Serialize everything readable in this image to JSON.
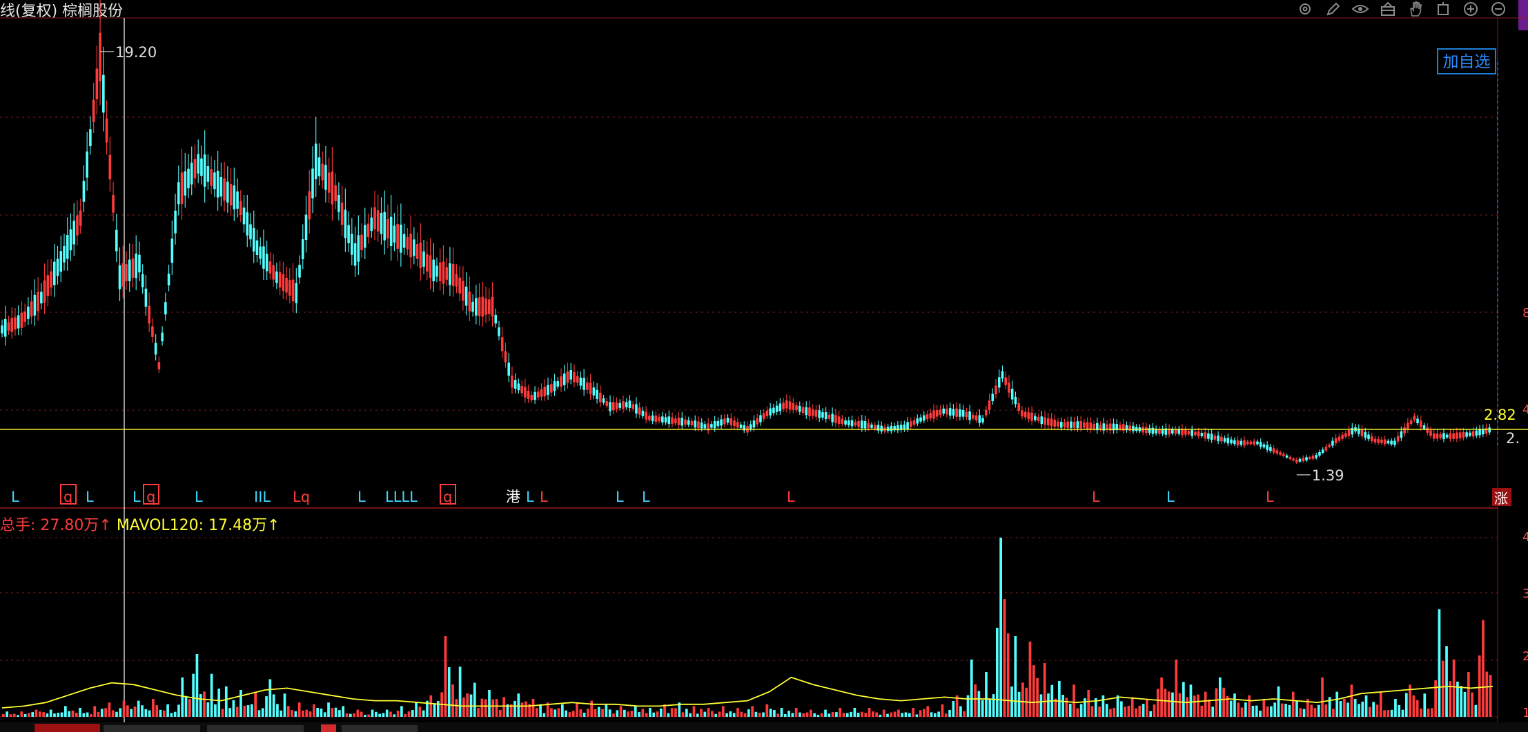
{
  "window": {
    "title": "线(复权) 棕榈股份"
  },
  "toolbar": {
    "icons": [
      "gear-icon",
      "pen-icon",
      "eye-icon",
      "basket-icon",
      "hand-icon",
      "square-icon",
      "zoom-in-icon",
      "zoom-out-icon"
    ]
  },
  "price_panel": {
    "high_label": "19.20",
    "low_label": "1.39",
    "last_label": "2.82",
    "right_cut_label": "2.",
    "add_watch_label": "加自选",
    "axis_cut_labels": [
      "8",
      "4"
    ],
    "signal_markers": [
      "L",
      "q",
      "L",
      "L",
      "q",
      "L",
      "IIL",
      "Lq",
      "L",
      "LLLL",
      "q",
      "港",
      "L",
      "L",
      "L",
      "L",
      "L",
      "L",
      "L",
      "L"
    ],
    "end_badge": "涨"
  },
  "volume_panel": {
    "legend_vol": "总手: 27.80万↑",
    "legend_ma": "MAVOL120: 17.48万↑",
    "axis_cut_labels": [
      "4",
      "3",
      "2",
      "1"
    ]
  },
  "colors": {
    "background": "#000000",
    "up": "#ff3b3b",
    "down": "#54ffff",
    "ma_line": "#ffff33",
    "grid": "#8a1a1a",
    "accent_blue": "#2a8cff",
    "crosshair": "#ffffff"
  },
  "chart_data": [
    {
      "type": "line",
      "series": [
        {
          "values": [
            7.2,
            7.6,
            8.6,
            10.2,
            12.1,
            19.2,
            9.5,
            10.1,
            5.6,
            13.2,
            14.5,
            13.6,
            12.9,
            10.8,
            9.5,
            8.8,
            14.6,
            13.2,
            10.5,
            12.1,
            11.4,
            10.8,
            9.8,
            9.6,
            8.2,
            8.2,
            4.9,
            4.2,
            4.6,
            5.2,
            4.6,
            3.8,
            3.9,
            3.3,
            3.2,
            3.1,
            2.9,
            3.2,
            2.8,
            3.5,
            3.9,
            3.6,
            3.4,
            3.1,
            3.0,
            2.8,
            2.9,
            3.3,
            3.6,
            3.5,
            3.2,
            5.2,
            3.5,
            3.2,
            3.0,
            3.0,
            2.9,
            2.9,
            2.8,
            2.7,
            2.7,
            2.6,
            2.4,
            2.2,
            2.2,
            1.8,
            1.4,
            1.6,
            2.3,
            2.8,
            2.3,
            2.2,
            3.3,
            2.5,
            2.5,
            2.6,
            2.8
          ]
        }
      ]
    },
    {
      "type": "bar",
      "series": [
        {
          "values": [
            3,
            3,
            4,
            4,
            6,
            5,
            6,
            8,
            9,
            9,
            10,
            7,
            22,
            35,
            24,
            17,
            15,
            14,
            21,
            13,
            8,
            7,
            8,
            6,
            4,
            4,
            4,
            6,
            8,
            12,
            45,
            28,
            19,
            15,
            11,
            13,
            10,
            8,
            7,
            8,
            9,
            7,
            6,
            6,
            5,
            7,
            8,
            6,
            5,
            6,
            5,
            6,
            7,
            5,
            5,
            4,
            4,
            5,
            5,
            5,
            4,
            4,
            5,
            6,
            7,
            12,
            32,
            25,
            100,
            45,
            42,
            30,
            20,
            18,
            15,
            12,
            12,
            11,
            10,
            22,
            32,
            18,
            14,
            22,
            13,
            12,
            10,
            17,
            14,
            10,
            22,
            14,
            18,
            12,
            14,
            10,
            18,
            13,
            60,
            32,
            25,
            54
          ]
        },
        {
          "values": [
            5,
            6,
            8,
            12,
            16,
            19,
            18,
            15,
            12,
            10,
            9,
            12,
            15,
            16,
            14,
            12,
            10,
            9,
            9,
            8,
            7,
            6,
            6,
            6,
            6,
            7,
            8,
            7,
            7,
            6,
            6,
            7,
            7,
            8,
            9,
            14,
            22,
            18,
            15,
            12,
            10,
            9,
            10,
            11,
            10,
            10,
            9,
            8,
            9,
            8,
            9,
            11,
            10,
            9,
            8,
            9,
            10,
            9,
            10,
            9,
            8,
            10,
            13,
            14,
            15,
            16,
            17,
            16,
            17
          ]
        }
      ]
    }
  ]
}
